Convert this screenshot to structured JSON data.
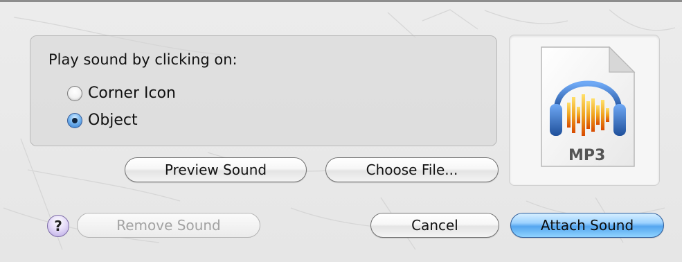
{
  "dialog": {
    "group_label": "Play sound by clicking on:",
    "options": [
      {
        "label": "Corner Icon",
        "selected": false
      },
      {
        "label": "Object",
        "selected": true
      }
    ],
    "buttons": {
      "preview": "Preview Sound",
      "choose": "Choose File...",
      "remove": "Remove Sound",
      "cancel": "Cancel",
      "attach": "Attach Sound",
      "help": "?"
    },
    "file_icon": {
      "icon": "mp3-file-icon",
      "label": "MP3"
    }
  },
  "colors": {
    "default_button": "#55a6ef",
    "headphones": "#1f5fb0",
    "waveform": "#f0a21d"
  }
}
